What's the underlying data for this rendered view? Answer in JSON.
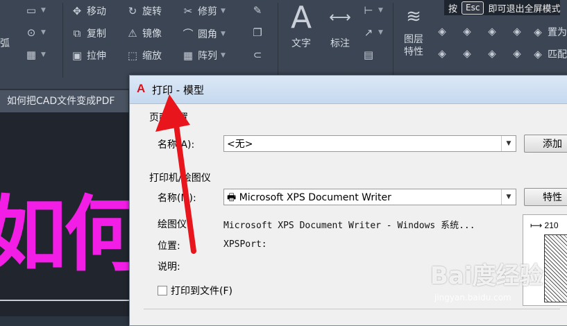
{
  "ribbon": {
    "items": [
      {
        "label": "移动",
        "icon": "move-icon"
      },
      {
        "label": "旋转",
        "icon": "rotate-icon"
      },
      {
        "label": "修剪",
        "icon": "trim-icon"
      },
      {
        "label": "复制",
        "icon": "copy-icon"
      },
      {
        "label": "镜像",
        "icon": "mirror-icon"
      },
      {
        "label": "圆角",
        "icon": "fillet-icon"
      },
      {
        "label": "拉伸",
        "icon": "stretch-icon"
      },
      {
        "label": "缩放",
        "icon": "scale-icon"
      },
      {
        "label": "阵列",
        "icon": "array-icon"
      }
    ],
    "partial_left": "弧",
    "text_tool": "文字",
    "dim_tool": "标注",
    "layer_props_1": "图层",
    "layer_props_2": "特性",
    "right_1": "置为",
    "right_2": "匹配"
  },
  "esc_hint": {
    "prefix": "按",
    "key": "Esc",
    "suffix": "即可退出全屏模式"
  },
  "doc_tab": "如何把CAD文件变成PDF",
  "canvas": {
    "text": "如何把",
    "text_color": "#f21ee6"
  },
  "dialog": {
    "title": "打印 - 模型",
    "page_setup": {
      "group": "页面设置",
      "name_label": "名称(A):",
      "name_value": "<无>",
      "add_button": "添加"
    },
    "printer": {
      "group": "打印机/绘图仪",
      "name_label": "名称(M):",
      "name_value": "Microsoft XPS Document Writer",
      "properties_button": "特性",
      "plotter_label": "绘图仪:",
      "plotter_value": "Microsoft XPS Document Writer - Windows 系统...",
      "location_label": "位置:",
      "location_value": "XPSPort:",
      "desc_label": "说明:",
      "print_to_file": "打印到文件(F)"
    },
    "preview_dim": "210"
  },
  "watermark": {
    "text": "Bai度经验",
    "sub": "jingyan.baidu.com"
  }
}
